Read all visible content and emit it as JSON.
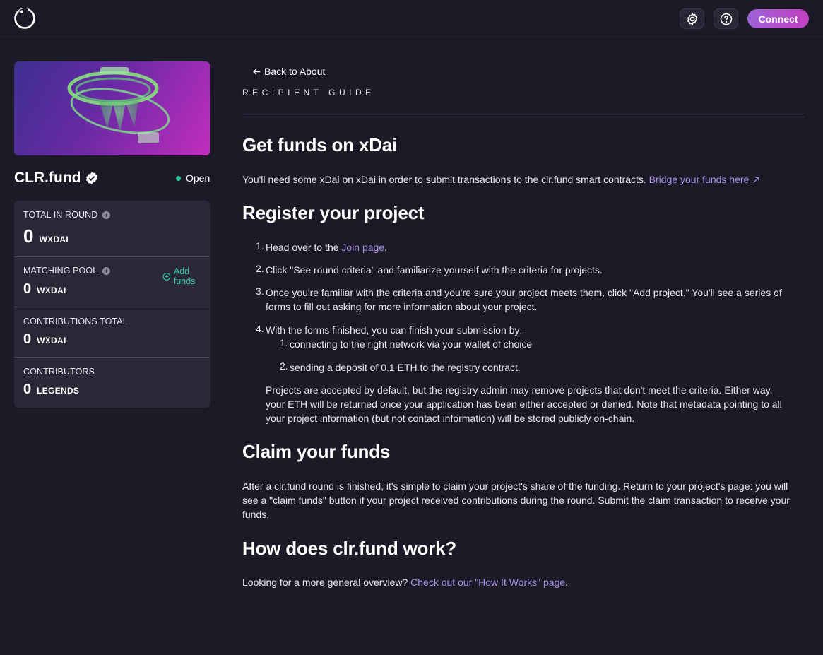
{
  "header": {
    "connect_label": "Connect"
  },
  "sidebar": {
    "round_name": "CLR.fund",
    "status": "Open",
    "stats": [
      {
        "label": "TOTAL IN ROUND",
        "value": "0",
        "unit": "WXDAI"
      },
      {
        "label": "MATCHING POOL",
        "value": "0",
        "unit": "WXDAI",
        "action": "Add funds"
      },
      {
        "label": "CONTRIBUTIONS TOTAL",
        "value": "0",
        "unit": "WXDAI"
      },
      {
        "label": "CONTRIBUTORS",
        "value": "0",
        "unit": "LEGENDS"
      }
    ]
  },
  "main": {
    "back_link": "Back to About",
    "guide_label": "RECIPIENT GUIDE",
    "sections": {
      "xdai": {
        "title": "Get funds on xDai",
        "text": "You'll need some xDai on xDai in order to submit transactions to the clr.fund smart contracts.",
        "link": "Bridge your funds here"
      },
      "register": {
        "title": "Register your project",
        "steps": [
          {
            "num": "1.",
            "before": "Head over to the ",
            "link": "Join page",
            "after": "."
          },
          {
            "num": "2.",
            "text_line1": "Click \"See round criteria\" and familiarize yourself with the criteria for projects."
          },
          {
            "num": "3.",
            "text_line1": "Once you're familiar with the criteria and you're sure your project meets them, click \"Add project.\" You'll see a series of",
            "text_line2": "forms to fill out asking for more information about your project."
          },
          {
            "num": "4.",
            "text_line1": "With the forms finished, you can finish your submission by:"
          }
        ],
        "substeps": [
          {
            "num": "1.",
            "text": "connecting to the right network via your wallet of choice"
          },
          {
            "num": "2.",
            "text": "sending a deposit of 0.1 ETH to the registry contract."
          }
        ],
        "note_lines": [
          "Projects are accepted by default, but the registry admin may remove projects that don't meet the criteria. Either way,",
          "your ETH will be returned once your application has been either accepted or denied. Note that metadata pointing to all",
          "your project information (but not contact information) will be stored publicly on-chain."
        ]
      },
      "claim": {
        "title": "Claim your funds",
        "lines": [
          "After a clr.fund round is finished, it's simple to claim your project's share of the funding. Return to your project's page: you will",
          "see a \"claim funds\" button if your project received contributions during the round. Submit the claim transaction to receive your",
          "funds."
        ]
      },
      "how": {
        "title": "How does clr.fund work?",
        "text": "Looking for a more general overview?",
        "link": "Check out our \"How It Works\" page",
        "after": "."
      }
    }
  }
}
